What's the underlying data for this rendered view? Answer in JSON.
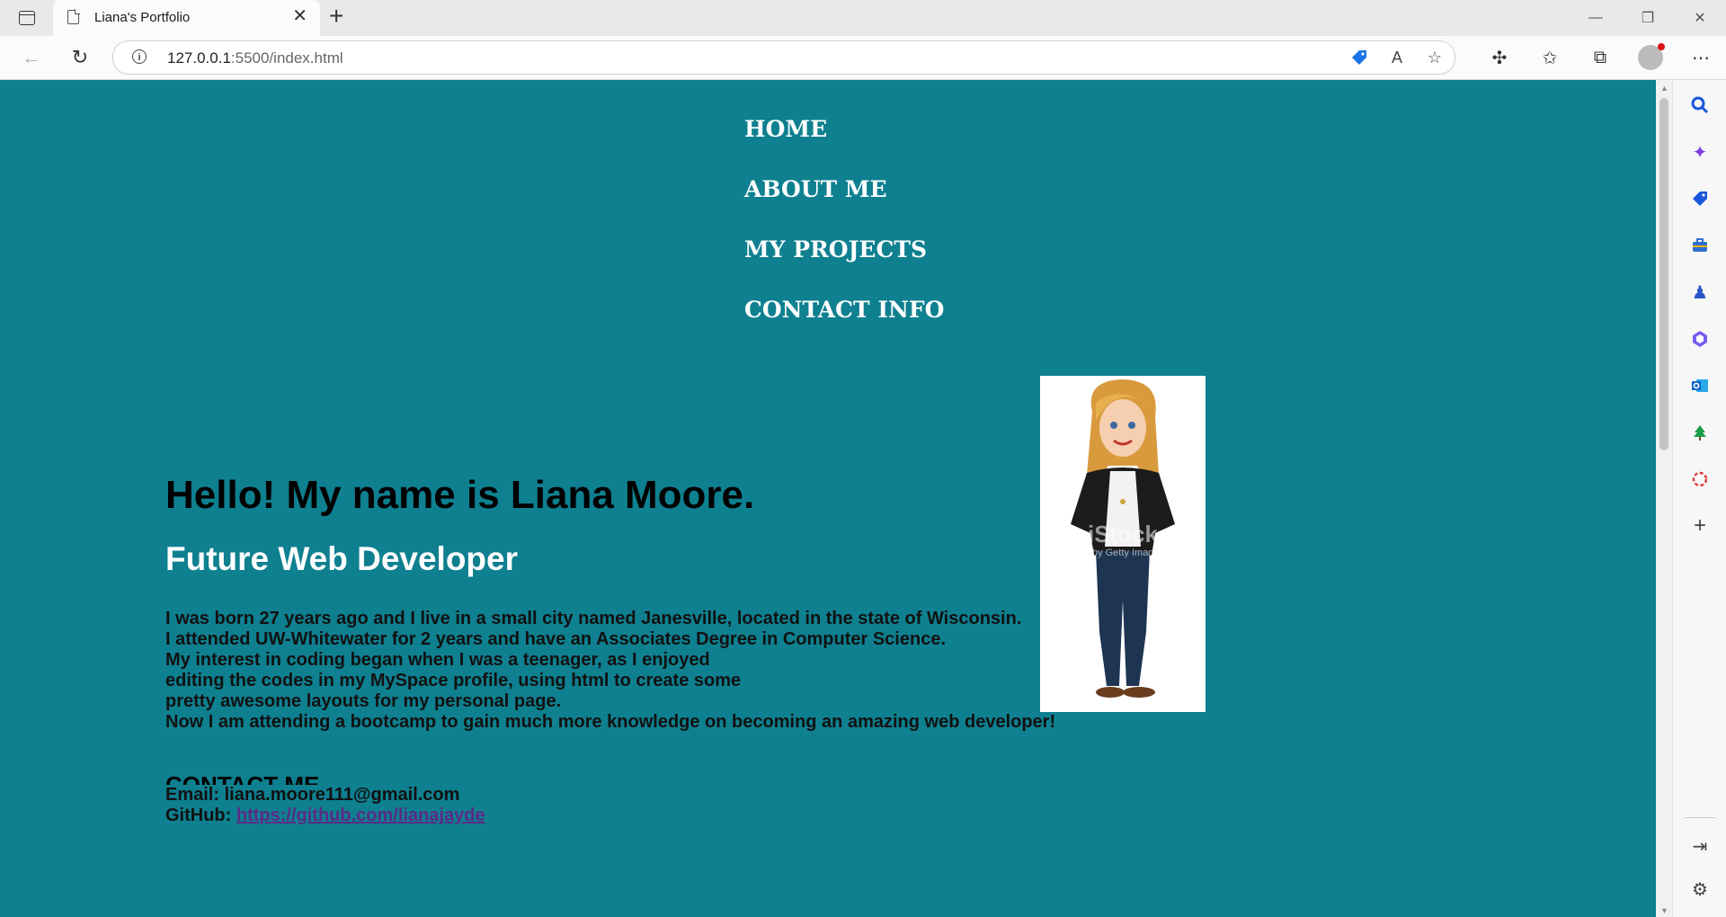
{
  "browser": {
    "tab_title": "Liana's Portfolio",
    "tab_close": "✕",
    "new_tab": "+",
    "url_host": "127.0.0.1",
    "url_rest": ":5500/index.html",
    "window_controls": {
      "minimize": "—",
      "maximize": "❐",
      "close": "✕"
    }
  },
  "nav": {
    "home": "HOME",
    "about": "ABOUT ME",
    "projects": "MY PROJECTS",
    "contact": "CONTACT INFO"
  },
  "intro": {
    "heading": "Hello! My name is Liana Moore.",
    "subheading": "Future Web Developer"
  },
  "bio": [
    "I was born 27 years ago and I live in a small city named Janesville, located in the state of Wisconsin.",
    "I attended UW-Whitewater for 2 years and have an Associates Degree in Computer Science.",
    "My interest in coding began when I was a teenager, as I enjoyed",
    "editing the codes in my MySpace profile, using html to create some",
    "pretty awesome layouts for my personal page.",
    "Now I am attending a bootcamp to gain much more knowledge on becoming an amazing web developer!"
  ],
  "contact": {
    "heading": "CONTACT ME",
    "email_label": "Email:",
    "email": "liana.moore111@gmail.com",
    "github_label": "GitHub:",
    "github_url": "https://github.com/lianajayde"
  },
  "portrait": {
    "watermark": "iStock",
    "watermark_sub": "by Getty Images"
  },
  "colors": {
    "page_bg": "#0e8090",
    "link": "#5a2b86"
  }
}
